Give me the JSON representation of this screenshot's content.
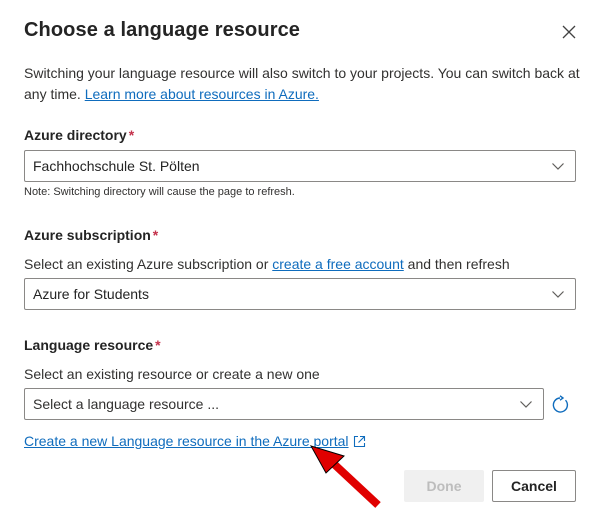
{
  "dialog": {
    "title": "Choose a language resource",
    "description": "Switching your language resource will also switch to your projects. You can switch back at any time.",
    "description_link": "Learn more about resources in Azure."
  },
  "directory": {
    "label": "Azure directory",
    "required_mark": "*",
    "value": "Fachhochschule St. Pölten",
    "note": "Note: Switching directory will cause the page to refresh."
  },
  "subscription": {
    "label": "Azure subscription",
    "required_mark": "*",
    "help_prefix": "Select an existing Azure subscription or",
    "help_link": "create a free account",
    "help_suffix": "and then refresh",
    "value": "Azure for Students"
  },
  "language_resource": {
    "label": "Language resource",
    "required_mark": "*",
    "help": "Select an existing resource or create a new one",
    "placeholder": "Select a language resource ..."
  },
  "create_link": "Create a new Language resource in the Azure portal",
  "buttons": {
    "done": "Done",
    "cancel": "Cancel"
  },
  "icons": {
    "close": "close-icon",
    "chevron": "chevron-down-icon",
    "refresh": "refresh-icon",
    "external": "open-external-icon",
    "annotation": "red-arrow"
  },
  "colors": {
    "link": "#0f6cbd",
    "required": "#c4314b",
    "annotation_arrow": "#e00000",
    "disabled_bg": "#f0f0f0"
  }
}
